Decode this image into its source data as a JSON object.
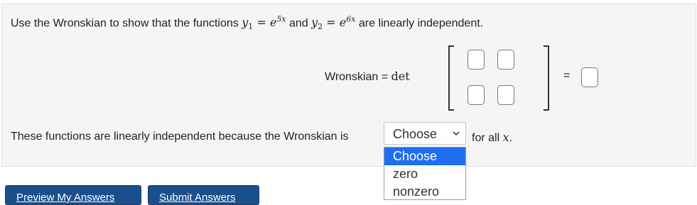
{
  "problem": {
    "intro": "Use the Wronskian to show that the functions",
    "y1_var": "y",
    "y1_sub": "1",
    "eq1": " = ",
    "y1_base": "e",
    "y1_exp": "5x",
    "and": "and",
    "y2_var": "y",
    "y2_sub": "2",
    "eq2": " = ",
    "y2_base": "e",
    "y2_exp": "6x",
    "outro": "are linearly independent."
  },
  "wronskian": {
    "label": "Wronskian = ",
    "det": "det",
    "equals": "="
  },
  "conclusion": {
    "prefix": "These functions are linearly independent because the Wronskian is",
    "suffix_text": "for all",
    "suffix_var": "x",
    "suffix_end": "."
  },
  "select": {
    "value": "Choose",
    "options": [
      "Choose",
      "zero",
      "nonzero"
    ],
    "highlighted": "Choose"
  },
  "buttons": {
    "preview": "Preview My Answers",
    "submit": "Submit Answers"
  },
  "colors": {
    "button": "#1a4f8c",
    "highlight": "#1e6ff0"
  }
}
